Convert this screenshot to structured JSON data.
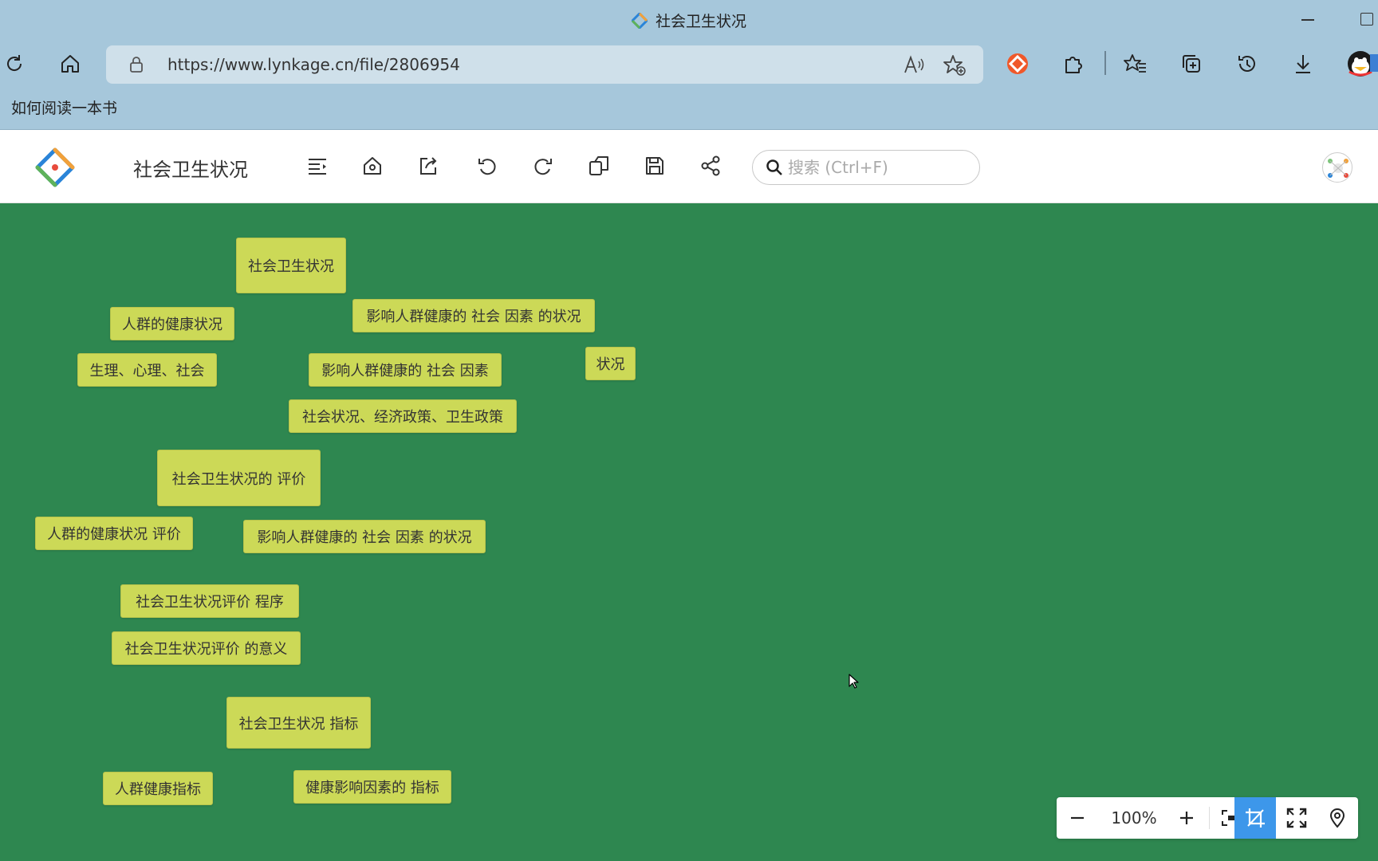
{
  "window": {
    "title": "社会卫生状况"
  },
  "browser": {
    "url": "https://www.lynkage.cn/file/2806954",
    "bookmarks": [
      "如何阅读一本书"
    ]
  },
  "app": {
    "title": "社会卫生状况",
    "search_placeholder": "搜索 (Ctrl+F)",
    "toolbar_icons": [
      "outline-icon",
      "home-icon",
      "export-icon",
      "undo-icon",
      "redo-icon",
      "copy-icon",
      "save-icon",
      "share-icon"
    ]
  },
  "mindmap": {
    "nodes": [
      "社会卫生状况",
      "人群的健康状况",
      "影响人群健康的 社会 因素 的状况",
      "生理、心理、社会",
      "影响人群健康的 社会 因素",
      "状况",
      "社会状况、经济政策、卫生政策",
      "社会卫生状况的  评价",
      "人群的健康状况 评价",
      "影响人群健康的 社会 因素 的状况",
      "社会卫生状况评价  程序",
      "社会卫生状况评价 的意义",
      "社会卫生状况 指标",
      "人群健康指标",
      "健康影响因素的 指标"
    ]
  },
  "zoom": {
    "level": "100%"
  },
  "colors": {
    "canvas_bg": "#2e8750",
    "node_bg": "#ccd957",
    "chrome_bg": "#a6c7db",
    "active_tool": "#3d97ea"
  }
}
